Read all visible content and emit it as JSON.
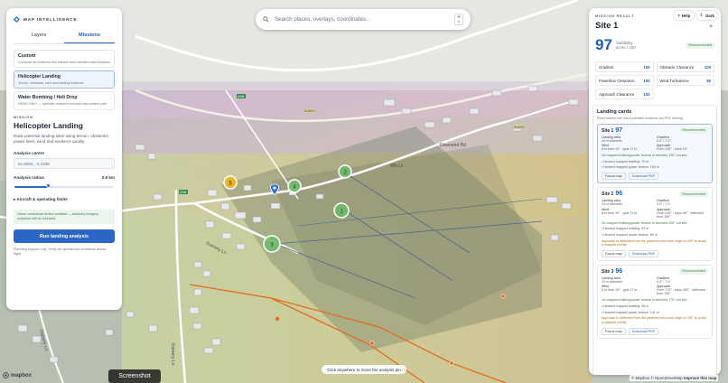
{
  "brand": {
    "name": "MAP INTELLIGENCE"
  },
  "left_panel": {
    "tabs": [
      {
        "label": "Layers"
      },
      {
        "label": "Missions"
      }
    ],
    "active_tab": "Missions",
    "missions": [
      {
        "title": "Custom",
        "desc": "Compose an evidence-first mission from selected data functions"
      },
      {
        "title": "Helicopter Landing",
        "desc": "Terrain, obstacles, wind and landing evidence"
      },
      {
        "title": "Water Bombing / Heli Drop",
        "desc": "DEMO ONLY — synthetic incident front and map-context path"
      }
    ],
    "section_label": "MISSION",
    "mission_heading": "Helicopter Landing",
    "mission_desc": "Rank potential landing sites using terrain, obstacles, power lines, wind and evidence quality.",
    "analysis_centre_label": "Analysis centre",
    "analysis_centre_value": "51.6604, -2.4459",
    "analysis_radius_label": "Analysis radius",
    "analysis_radius_value": "0.6 km",
    "radius_fraction": 0.34,
    "aircraft_toggle": "▸ Aircraft & operating limits",
    "notice": "Vision contextual review enabled — advisory imagery evidence will be included.",
    "run_button": "Run landing analysis",
    "footnote": "Planning support only. Verify all operational conditions before flight."
  },
  "search": {
    "placeholder": "Search places, overlays, coordinates...",
    "shortcut_top": "⌘",
    "shortcut_bottom": "K"
  },
  "right_panel": {
    "label": "MISSION RESULT",
    "title": "Site 1",
    "help": "Help",
    "theme": "Dark",
    "close": "×",
    "score": "97",
    "score_label_1": "Suitability",
    "score_label_2": "score / 100",
    "badge": "Recommended",
    "metrics": [
      {
        "name": "Gradient",
        "value": "100"
      },
      {
        "name": "Obstacle Clearance",
        "value": "100"
      },
      {
        "name": "Powerline Clearance",
        "value": "100"
      },
      {
        "name": "Wind Turbulence",
        "value": "80"
      },
      {
        "name": "Approach Clearance",
        "value": "100"
      }
    ],
    "landing_cards_title": "Landing cards",
    "landing_cards_sub": "Every ranked site has a printable evidence-led PDF briefing.",
    "cards": [
      {
        "site": "Site 1",
        "score": "97",
        "badge": "Recommended",
        "landing_area_k": "Landing area",
        "landing_area_v": "24 m diameter",
        "gradient_k": "Gradient",
        "gradient_v": "0.0° / 7.0°",
        "wind_k": "Wind",
        "wind_v": "8 kt from 15° · gust 17 kt",
        "approach_k": "Approach",
        "approach_v": "From 195° · track 15°",
        "note": "No mapped building/power feature in selected 195° corridor",
        "bullets": [
          "• Nearest mapped building: 70 m",
          "• Nearest mapped power feature: 160 m"
        ],
        "warn": "",
        "focus": "Focus map",
        "pdf": "Download PDF"
      },
      {
        "site": "Site 2",
        "score": "96",
        "badge": "Recommended",
        "landing_area_k": "Landing area",
        "landing_area_v": "24 m diameter",
        "gradient_k": "Gradient",
        "gradient_v": "0.0° / 7.0°",
        "wind_k": "Wind",
        "wind_v": "8 kt from 15° · gust 17 kt",
        "approach_k": "Approach",
        "approach_v": "From 225° · track 45° · deflected from 195°",
        "note": "No mapped building/power feature in selected 225° corridor",
        "bullets": [
          "• Nearest mapped building: 93 m",
          "• Nearest mapped power feature: 89 m"
        ],
        "warn": "Approach is deflected from the preferred into-wind origin of 195° to avoid a mapped overfly.",
        "focus": "Focus map",
        "pdf": "Download PDF"
      },
      {
        "site": "Site 3",
        "score": "96",
        "badge": "Recommended",
        "landing_area_k": "Landing area",
        "landing_area_v": "24 m diameter",
        "gradient_k": "Gradient",
        "gradient_v": "0.0° / 7.0°",
        "wind_k": "Wind",
        "wind_v": "8 kt from 15° · gust 17 kt",
        "approach_k": "Approach",
        "approach_v": "From 175° · track 355° · deflected from 195°",
        "note": "No mapped building/power feature in selected 175° corridor",
        "bullets": [
          "• Nearest mapped building: 58 m",
          "• Nearest mapped power feature: 141 m"
        ],
        "warn": "Approach is deflected from the preferred into-wind origin of 195° to avoid a mapped overfly.",
        "focus": "Focus map",
        "pdf": "Download PDF"
      }
    ]
  },
  "map": {
    "hint": "Click anywhere to move the analysis pin",
    "screenshot_label": "Screenshot",
    "mapbox": "mapbox",
    "attribution_a": "© Mapbox © OpenStreetMap",
    "attribution_b": "Improve this map",
    "markers": [
      {
        "label": "1",
        "type": "site"
      },
      {
        "label": "2",
        "type": "site"
      },
      {
        "label": "3",
        "type": "site"
      },
      {
        "label": "4",
        "type": "site"
      },
      {
        "label": "5",
        "type": "selected"
      }
    ],
    "road_labels": [
      "Downend Rd",
      "Damery Ln",
      "Damery Ln",
      "Damery Ln",
      "Mill Ln"
    ],
    "road_numbers": [
      "A38",
      "A38",
      "B4058",
      "B4509",
      "B4058"
    ],
    "colors": {
      "accent": "#2a66c6",
      "marker_green": "#3aa34f",
      "marker_yellow": "#e9b52b",
      "pin": "#2c6fd6",
      "powerline": "#e56b1f",
      "recommended": "#3c7a48"
    }
  }
}
